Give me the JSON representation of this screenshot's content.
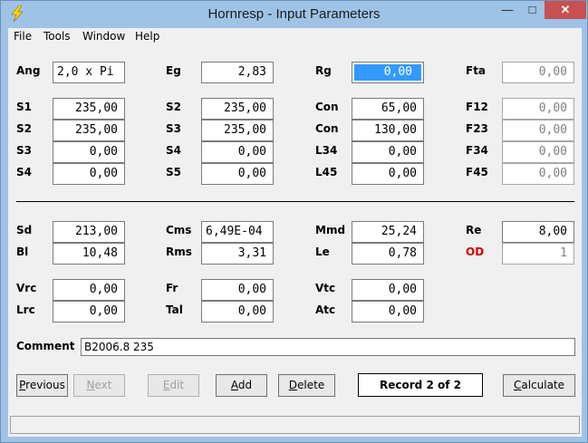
{
  "window": {
    "title": "Hornresp - Input Parameters",
    "minimize": "—",
    "maximize": "□",
    "close": "✕"
  },
  "menu": [
    "File",
    "Tools",
    "Window",
    "Help"
  ],
  "top_section": {
    "col1": [
      {
        "label": "Ang",
        "value": "2,0 x Pi"
      },
      {
        "label": "S1",
        "value": "235,00"
      },
      {
        "label": "S2",
        "value": "235,00"
      },
      {
        "label": "S3",
        "value": "0,00"
      },
      {
        "label": "S4",
        "value": "0,00"
      }
    ],
    "col2": [
      {
        "label": "Eg",
        "value": "2,83"
      },
      {
        "label": "S2",
        "value": "235,00"
      },
      {
        "label": "S3",
        "value": "235,00"
      },
      {
        "label": "S4",
        "value": "0,00"
      },
      {
        "label": "S5",
        "value": "0,00"
      }
    ],
    "col3": [
      {
        "label": "Rg",
        "value": "0,00"
      },
      {
        "label": "Con",
        "value": "65,00"
      },
      {
        "label": "Con",
        "value": "130,00"
      },
      {
        "label": "L34",
        "value": "0,00"
      },
      {
        "label": "L45",
        "value": "0,00"
      }
    ],
    "col4": [
      {
        "label": "Fta",
        "value": "0,00"
      },
      {
        "label": "F12",
        "value": "0,00"
      },
      {
        "label": "F23",
        "value": "0,00"
      },
      {
        "label": "F34",
        "value": "0,00"
      },
      {
        "label": "F45",
        "value": "0,00"
      }
    ]
  },
  "bottom_section": {
    "col1": [
      {
        "label": "Sd",
        "value": "213,00"
      },
      {
        "label": "Bl",
        "value": "10,48"
      },
      {
        "label": "Vrc",
        "value": "0,00"
      },
      {
        "label": "Lrc",
        "value": "0,00"
      }
    ],
    "col2": [
      {
        "label": "Cms",
        "value": "6,49E-04"
      },
      {
        "label": "Rms",
        "value": "3,31"
      },
      {
        "label": "Fr",
        "value": "0,00"
      },
      {
        "label": "Tal",
        "value": "0,00"
      }
    ],
    "col3": [
      {
        "label": "Mmd",
        "value": "25,24"
      },
      {
        "label": "Le",
        "value": "0,78"
      },
      {
        "label": "Vtc",
        "value": "0,00"
      },
      {
        "label": "Atc",
        "value": "0,00"
      }
    ],
    "col4": [
      {
        "label": "Re",
        "value": "8,00"
      },
      {
        "label": "OD",
        "value": "1"
      }
    ]
  },
  "comment": {
    "label": "Comment",
    "value": "B2006.8 235"
  },
  "buttons": {
    "previous": {
      "first": "P",
      "rest": "revious"
    },
    "next": {
      "first": "N",
      "rest": "ext"
    },
    "edit": {
      "first": "E",
      "rest": "dit"
    },
    "add": {
      "first": "A",
      "rest": "dd"
    },
    "delete": {
      "first": "D",
      "rest": "elete"
    },
    "calculate": {
      "first": "C",
      "rest": "alculate"
    }
  },
  "record_status": "Record 2 of 2",
  "colors": {
    "title_bar": "#9fc3e7",
    "close_button": "#c75050",
    "selection": "#3399ff",
    "od_label": "#d00000"
  }
}
